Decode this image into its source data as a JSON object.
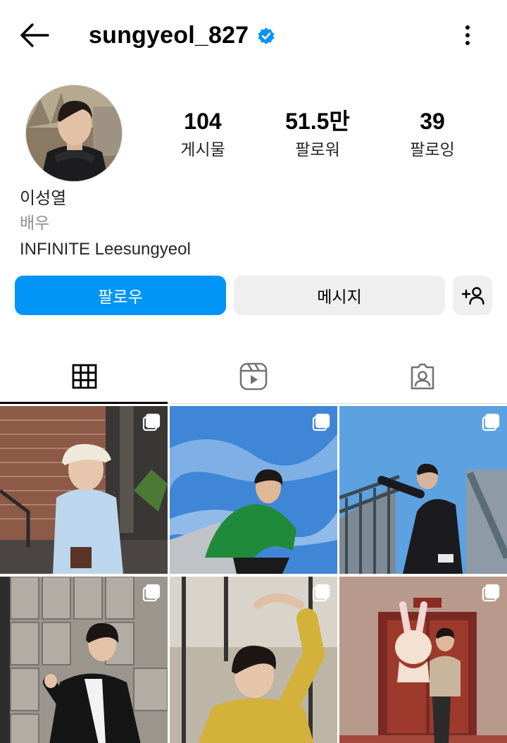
{
  "header": {
    "username": "sungyeol_827",
    "back_icon": "arrow-left-icon",
    "verified_icon": "verified-badge-icon",
    "more_icon": "more-vertical-icon"
  },
  "profile": {
    "stats": [
      {
        "value": "104",
        "label": "게시물"
      },
      {
        "value": "51.5만",
        "label": "팔로워"
      },
      {
        "value": "39",
        "label": "팔로잉"
      }
    ],
    "name": "이성열",
    "category": "배우",
    "bio": "INFINITE Leesungyeol"
  },
  "actions": {
    "follow_label": "팔로우",
    "message_label": "메시지",
    "suggest_icon": "add-person-icon"
  },
  "tabs": [
    {
      "icon": "grid-icon",
      "active": true
    },
    {
      "icon": "reels-icon",
      "active": false
    },
    {
      "icon": "tagged-icon",
      "active": false
    }
  ],
  "colors": {
    "accent": "#0095f6",
    "secondary_button": "#efefef",
    "verified": "#0095f6"
  },
  "posts": [
    {
      "multi": true,
      "icon": "multiple-posts-icon"
    },
    {
      "multi": true,
      "icon": "multiple-posts-icon"
    },
    {
      "multi": true,
      "icon": "multiple-posts-icon"
    },
    {
      "multi": true,
      "icon": "multiple-posts-icon"
    },
    {
      "multi": true,
      "icon": "multiple-posts-icon"
    },
    {
      "multi": true,
      "icon": "multiple-posts-icon"
    }
  ]
}
